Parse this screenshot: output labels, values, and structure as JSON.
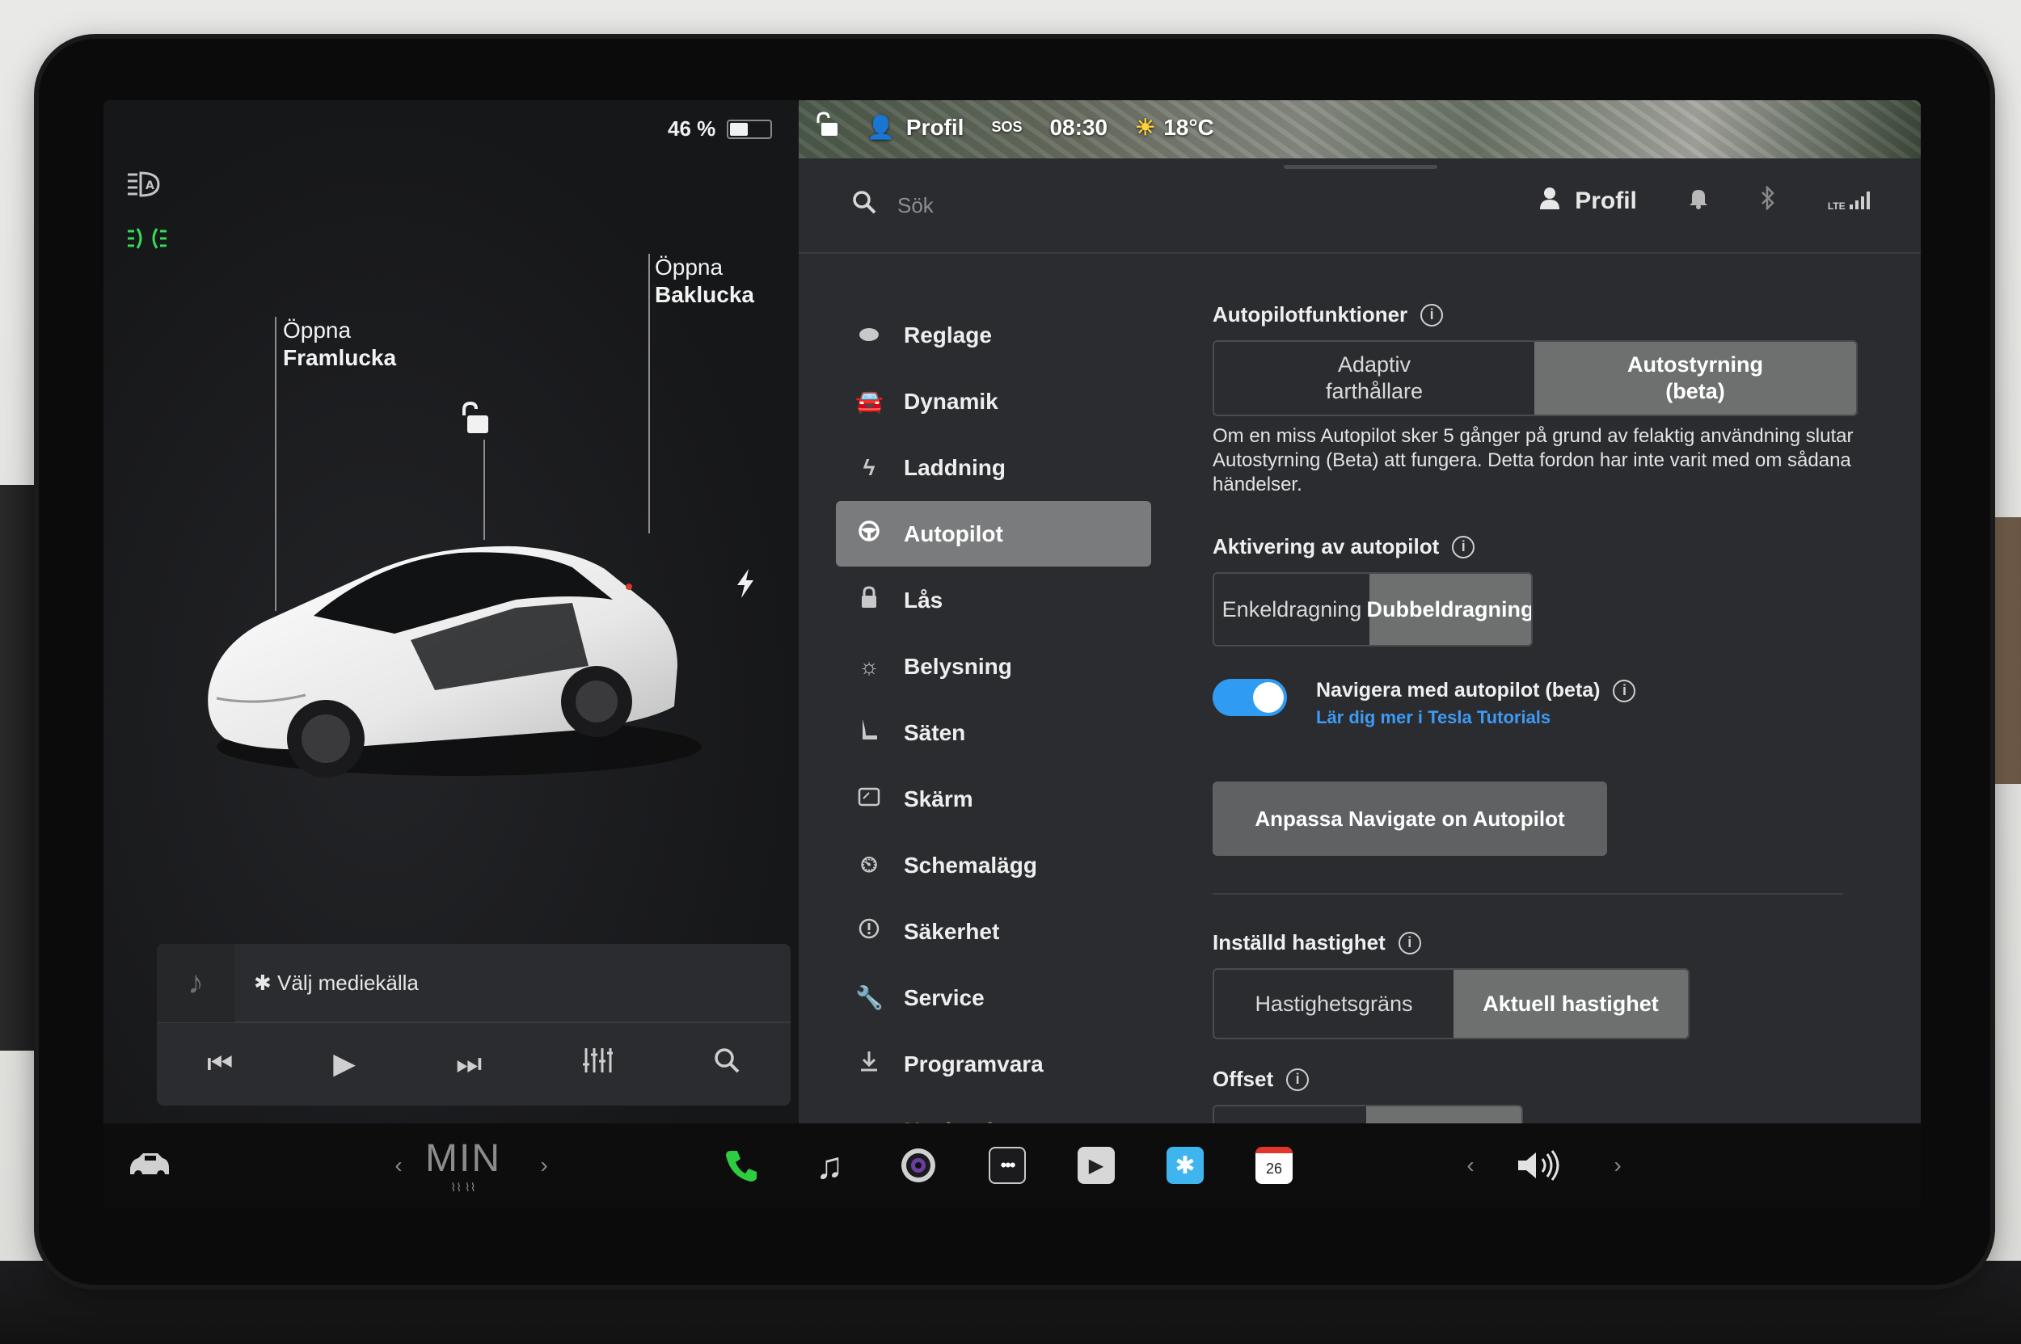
{
  "status": {
    "battery_percent": "46 %",
    "battery_level": 0.46,
    "profile_label": "Profil",
    "sos_label": "SOS",
    "time": "08:30",
    "temperature": "18°C"
  },
  "car": {
    "frunk_line1": "Öppna",
    "frunk_line2": "Framlucka",
    "trunk_line1": "Öppna",
    "trunk_line2": "Baklucka"
  },
  "media": {
    "source_label": "Välj mediekälla"
  },
  "settings": {
    "search_placeholder": "Sök",
    "profile_label": "Profil",
    "lte_label": "LTE",
    "menu": [
      {
        "label": "Reglage",
        "icon": "toggle-icon"
      },
      {
        "label": "Dynamik",
        "icon": "car-icon"
      },
      {
        "label": "Laddning",
        "icon": "bolt-icon"
      },
      {
        "label": "Autopilot",
        "icon": "steering-wheel-icon"
      },
      {
        "label": "Lås",
        "icon": "lock-icon"
      },
      {
        "label": "Belysning",
        "icon": "sun-icon"
      },
      {
        "label": "Säten",
        "icon": "seat-icon"
      },
      {
        "label": "Skärm",
        "icon": "display-icon"
      },
      {
        "label": "Schemalägg",
        "icon": "schedule-icon"
      },
      {
        "label": "Säkerhet",
        "icon": "safety-icon"
      },
      {
        "label": "Service",
        "icon": "wrench-icon"
      },
      {
        "label": "Programvara",
        "icon": "download-icon"
      },
      {
        "label": "Navigering",
        "icon": "navigation-icon"
      }
    ],
    "autopilot_features": {
      "title": "Autopilotfunktioner",
      "option1_line1": "Adaptiv",
      "option1_line2": "farthållare",
      "option2_line1": "Autostyrning",
      "option2_line2": "(beta)",
      "description": "Om en miss Autopilot sker 5 gånger på grund av felaktig användning slutar Autostyrning (Beta) att fungera. Detta fordon har inte varit med om sådana händelser."
    },
    "activation": {
      "title": "Aktivering av autopilot",
      "option1": "Enkeldragning",
      "option2": "Dubbeldragning"
    },
    "navigate": {
      "title": "Navigera med autopilot (beta)",
      "link": "Lär dig mer i Tesla Tutorials",
      "button": "Anpassa Navigate on Autopilot"
    },
    "set_speed": {
      "title": "Inställd hastighet",
      "option1": "Hastighetsgräns",
      "option2": "Aktuell hastighet"
    },
    "offset": {
      "title": "Offset"
    }
  },
  "dock": {
    "climate_label": "MIN",
    "calendar_day": "26"
  },
  "colors": {
    "accent_blue": "#2f9bf3",
    "link_blue": "#3d9bf5",
    "selected_segment": "#6e706f",
    "active_menu": "#7a7b7c",
    "phone_green": "#2ecc40",
    "headlight_green": "#33dd55"
  }
}
